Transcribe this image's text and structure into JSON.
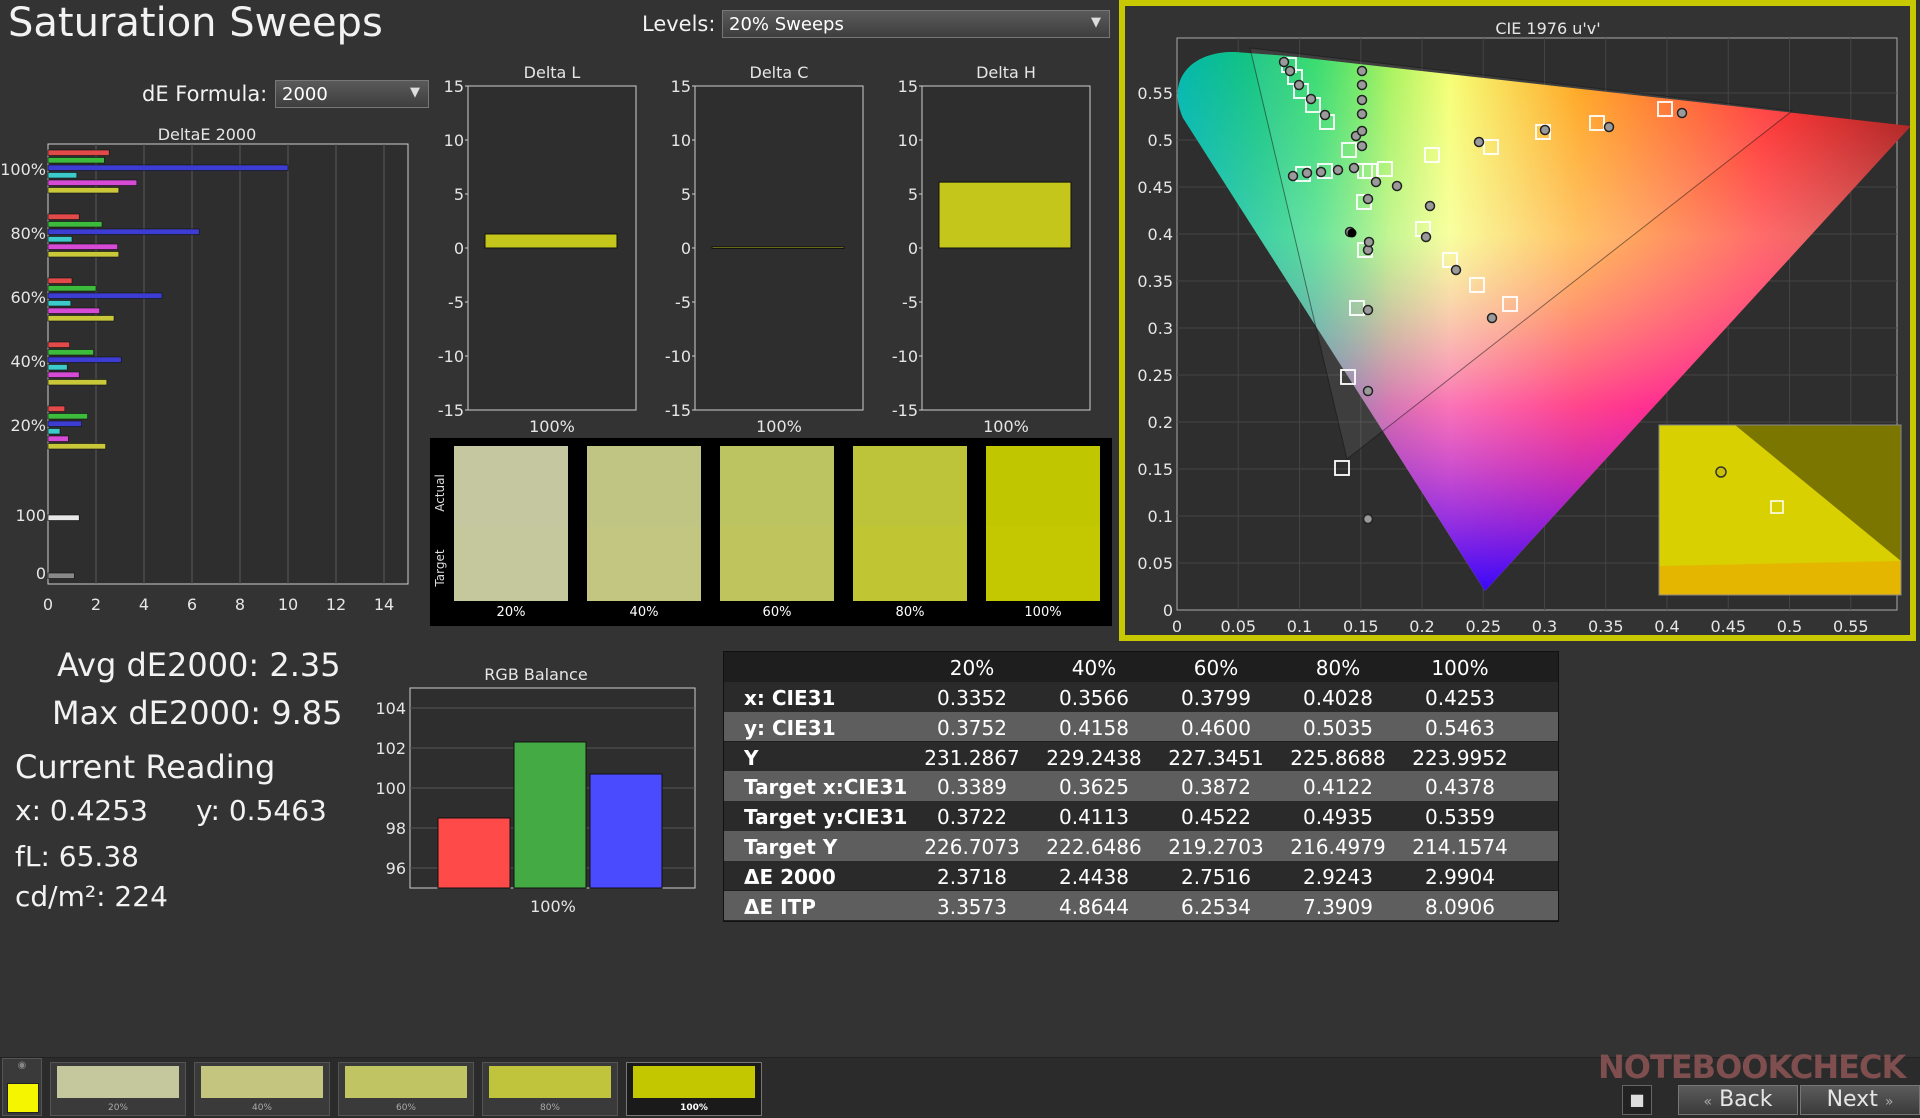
{
  "header": {
    "title": "Saturation Sweeps",
    "levels_label": "Levels:",
    "levels_value": "20% Sweeps",
    "de_formula_label": "dE Formula:",
    "de_formula_value": "2000"
  },
  "deltae_chart": {
    "title": "DeltaE 2000",
    "y_labels": [
      "100%",
      "80%",
      "60%",
      "40%",
      "20%",
      "100",
      "0"
    ],
    "x_ticks": [
      "0",
      "2",
      "4",
      "6",
      "8",
      "10",
      "12",
      "14"
    ],
    "groups": [
      {
        "label": "100%",
        "values": [
          2.55,
          2.35,
          10.0,
          1.2,
          3.7,
          2.95
        ]
      },
      {
        "label": "80%",
        "values": [
          1.3,
          2.25,
          6.3,
          1.0,
          2.9,
          2.95
        ]
      },
      {
        "label": "60%",
        "values": [
          1.0,
          2.0,
          4.75,
          0.95,
          2.15,
          2.75
        ]
      },
      {
        "label": "40%",
        "values": [
          0.9,
          1.9,
          3.05,
          0.8,
          1.3,
          2.45
        ]
      },
      {
        "label": "20%",
        "values": [
          0.7,
          1.65,
          1.4,
          0.5,
          0.85,
          2.4
        ]
      },
      {
        "label": "100",
        "values": [
          1.3
        ]
      },
      {
        "label": "0",
        "values": [
          1.1
        ]
      }
    ],
    "series_colors": [
      "#e24a4a",
      "#3dbb3d",
      "#3d3dd4",
      "#3ccaca",
      "#d64ad6",
      "#c8c83a"
    ]
  },
  "delta_charts": [
    {
      "title": "Delta L",
      "x_label": "100%",
      "value": 1.3,
      "y_ticks": [
        "15",
        "10",
        "5",
        "0",
        "-5",
        "-10",
        "-15"
      ]
    },
    {
      "title": "Delta C",
      "x_label": "100%",
      "value": 0.1,
      "y_ticks": [
        "15",
        "10",
        "5",
        "0",
        "-5",
        "-10",
        "-15"
      ]
    },
    {
      "title": "Delta H",
      "x_label": "100%",
      "value": 6.1,
      "y_ticks": [
        "15",
        "10",
        "5",
        "0",
        "-5",
        "-10",
        "-15"
      ]
    }
  ],
  "swatches": {
    "actual_label": "Actual",
    "target_label": "Target",
    "items": [
      {
        "label": "20%",
        "actual": "#c4c79f",
        "target": "#c5c89c"
      },
      {
        "label": "40%",
        "actual": "#c0c584",
        "target": "#c2c680"
      },
      {
        "label": "60%",
        "actual": "#bcc461",
        "target": "#bfc55c"
      },
      {
        "label": "80%",
        "actual": "#bec43a",
        "target": "#c0c533"
      },
      {
        "label": "100%",
        "actual": "#c0c700",
        "target": "#c4c800"
      }
    ]
  },
  "cie_chart": {
    "title": "CIE 1976 u'v'",
    "y_ticks": [
      "0.55",
      "0.5",
      "0.45",
      "0.4",
      "0.35",
      "0.3",
      "0.25",
      "0.2",
      "0.15",
      "0.1",
      "0.05",
      "0"
    ],
    "x_ticks": [
      "0",
      "0.05",
      "0.1",
      "0.15",
      "0.2",
      "0.25",
      "0.3",
      "0.35",
      "0.4",
      "0.45",
      "0.5",
      "0.55"
    ]
  },
  "stats": {
    "avg": "Avg dE2000: 2.35",
    "max": "Max dE2000: 9.85",
    "current_title": "Current Reading",
    "x": "x: 0.4253",
    "y": "y: 0.5463",
    "fl": "fL: 65.38",
    "cdm2": "cd/m²: 224"
  },
  "rgb_balance": {
    "title": "RGB Balance",
    "x_label": "100%",
    "y_ticks": [
      "104",
      "102",
      "100",
      "98",
      "96"
    ],
    "values": [
      98.5,
      102.3,
      100.7
    ],
    "colors": [
      "#ff4a4a",
      "#44aa44",
      "#4a4aff"
    ]
  },
  "readings": {
    "columns": [
      "20%",
      "40%",
      "60%",
      "80%",
      "100%"
    ],
    "rows": [
      {
        "label": "x: CIE31",
        "values": [
          "0.3352",
          "0.3566",
          "0.3799",
          "0.4028",
          "0.4253"
        ]
      },
      {
        "label": "y: CIE31",
        "values": [
          "0.3752",
          "0.4158",
          "0.4600",
          "0.5035",
          "0.5463"
        ]
      },
      {
        "label": "Y",
        "values": [
          "231.2867",
          "229.2438",
          "227.3451",
          "225.8688",
          "223.9952"
        ]
      },
      {
        "label": "Target x:CIE31",
        "values": [
          "0.3389",
          "0.3625",
          "0.3872",
          "0.4122",
          "0.4378"
        ]
      },
      {
        "label": "Target y:CIE31",
        "values": [
          "0.3722",
          "0.4113",
          "0.4522",
          "0.4935",
          "0.5359"
        ]
      },
      {
        "label": "Target Y",
        "values": [
          "226.7073",
          "222.6486",
          "219.2703",
          "216.4979",
          "214.1574"
        ]
      },
      {
        "label": "ΔE 2000",
        "values": [
          "2.3718",
          "2.4438",
          "2.7516",
          "2.9243",
          "2.9904"
        ]
      },
      {
        "label": "ΔE ITP",
        "values": [
          "3.3573",
          "4.8644",
          "6.2534",
          "7.3909",
          "8.0906"
        ]
      }
    ]
  },
  "bottom_bar": {
    "current_color": "#f5f500",
    "thumbs": [
      {
        "label": "20%",
        "color": "#c5c79c"
      },
      {
        "label": "40%",
        "color": "#c4c67f"
      },
      {
        "label": "60%",
        "color": "#c1c462"
      },
      {
        "label": "80%",
        "color": "#c0c43c"
      },
      {
        "label": "100%",
        "color": "#c2c700"
      }
    ],
    "back_label": "Back",
    "next_label": "Next",
    "watermark": "NOTEBOOKCHECK"
  }
}
